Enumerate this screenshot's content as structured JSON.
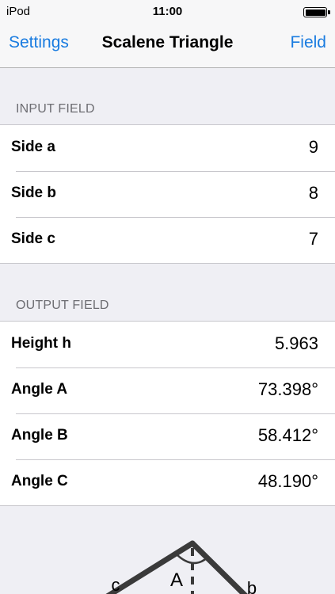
{
  "status_bar": {
    "carrier": "iPod",
    "time": "11:00"
  },
  "nav": {
    "left_button": "Settings",
    "title": "Scalene Triangle",
    "right_button": "Field"
  },
  "input_section": {
    "header": "INPUT FIELD",
    "rows": [
      {
        "label": "Side a",
        "value": "9"
      },
      {
        "label": "Side b",
        "value": "8"
      },
      {
        "label": "Side c",
        "value": "7"
      }
    ]
  },
  "output_section": {
    "header": "OUTPUT FIELD",
    "rows": [
      {
        "label": "Height h",
        "value": "5.963"
      },
      {
        "label": "Angle A",
        "value": "73.398°"
      },
      {
        "label": "Angle B",
        "value": "58.412°"
      },
      {
        "label": "Angle C",
        "value": "48.190°"
      }
    ]
  },
  "diagram": {
    "label_c": "c",
    "label_A": "A",
    "label_b": "b"
  },
  "colors": {
    "accent": "#1a7ce0",
    "background": "#efeff4",
    "diagram_stroke": "#3a3a3a"
  }
}
